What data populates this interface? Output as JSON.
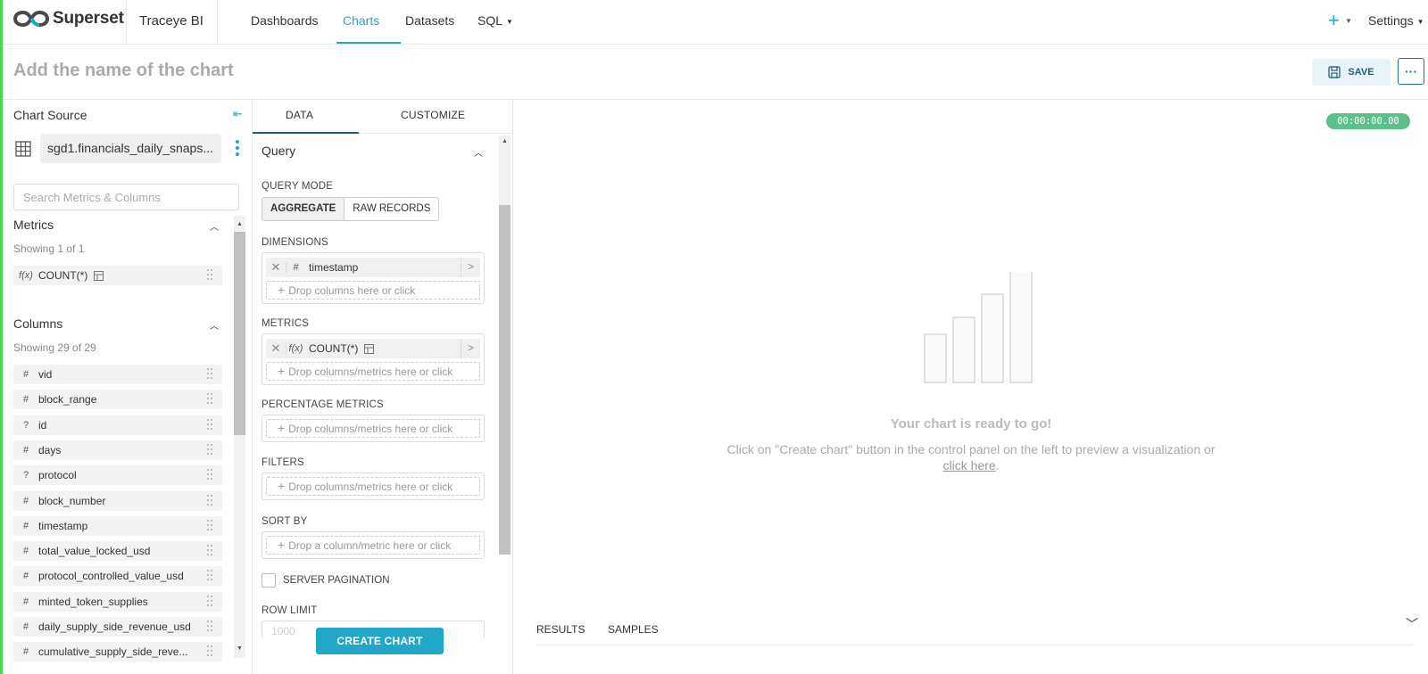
{
  "nav": {
    "logo_text": "Superset",
    "brand": "Traceye BI",
    "items": [
      {
        "label": "Dashboards",
        "active": false
      },
      {
        "label": "Charts",
        "active": true
      },
      {
        "label": "Datasets",
        "active": false
      },
      {
        "label": "SQL",
        "active": false
      }
    ],
    "plus": "+",
    "settings": "Settings"
  },
  "header": {
    "chart_title_placeholder": "Add the name of the chart",
    "save_label": "SAVE",
    "more_label": "···"
  },
  "source": {
    "title": "Chart Source",
    "dataset": "sgd1.financials_daily_snaps...",
    "search_placeholder": "Search Metrics & Columns"
  },
  "metrics": {
    "title": "Metrics",
    "showing": "Showing 1 of 1",
    "items": [
      {
        "type": "f(x)",
        "name": "COUNT(*)"
      }
    ]
  },
  "columns": {
    "title": "Columns",
    "showing": "Showing 29 of 29",
    "items": [
      {
        "type": "#",
        "name": "vid"
      },
      {
        "type": "#",
        "name": "block_range"
      },
      {
        "type": "?",
        "name": "id"
      },
      {
        "type": "#",
        "name": "days"
      },
      {
        "type": "?",
        "name": "protocol"
      },
      {
        "type": "#",
        "name": "block_number"
      },
      {
        "type": "#",
        "name": "timestamp"
      },
      {
        "type": "#",
        "name": "total_value_locked_usd"
      },
      {
        "type": "#",
        "name": "protocol_controlled_value_usd"
      },
      {
        "type": "#",
        "name": "minted_token_supplies"
      },
      {
        "type": "#",
        "name": "daily_supply_side_revenue_usd"
      },
      {
        "type": "#",
        "name": "cumulative_supply_side_reve..."
      }
    ]
  },
  "control": {
    "tabs": [
      "DATA",
      "CUSTOMIZE"
    ],
    "query_title": "Query",
    "query_mode_label": "QUERY MODE",
    "modes": [
      "AGGREGATE",
      "RAW RECORDS"
    ],
    "dimensions_label": "DIMENSIONS",
    "dimension_chip": {
      "type": "#",
      "name": "timestamp"
    },
    "dimensions_drop": "Drop columns here or click",
    "metrics_label": "METRICS",
    "metric_chip": {
      "type": "f(x)",
      "name": "COUNT(*)"
    },
    "metrics_drop": "Drop columns/metrics here or click",
    "pct_label": "PERCENTAGE METRICS",
    "pct_drop": "Drop columns/metrics here or click",
    "filters_label": "FILTERS",
    "filters_drop": "Drop columns/metrics here or click",
    "sort_label": "SORT BY",
    "sort_drop": "Drop a column/metric here or click",
    "pagination_label": "SERVER PAGINATION",
    "row_limit_label": "ROW LIMIT",
    "row_limit_value": "1000",
    "create_label": "CREATE CHART"
  },
  "chart_area": {
    "timer": "00:00:00.00",
    "ready_title": "Your chart is ready to go!",
    "hint_text": "Click on \"Create chart\" button in the control panel on the left to preview a visualization or",
    "hint_link": "click here",
    "hint_end": ".",
    "tabs": [
      "RESULTS",
      "SAMPLES"
    ]
  },
  "colors": {
    "accent": "#20a7c9",
    "timer": "#5ac189",
    "save_bg": "#e8f3f7"
  }
}
